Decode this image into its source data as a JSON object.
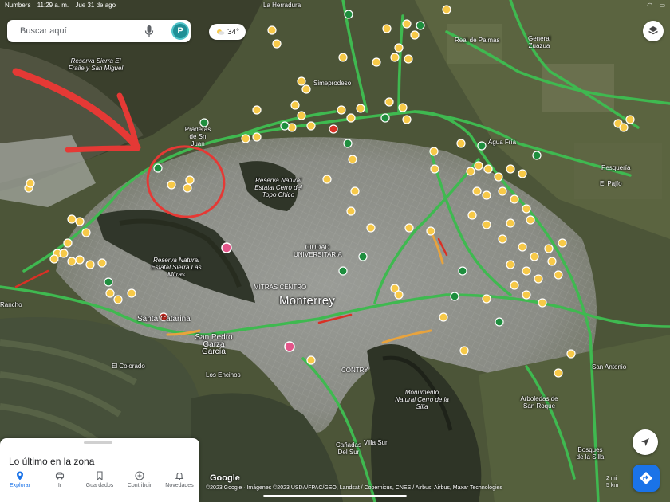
{
  "status_bar": {
    "carrier": "Numbers",
    "time": "11:29 a. m.",
    "date": "Jue 31 de ago",
    "battery": ""
  },
  "search": {
    "placeholder": "Buscar aquí",
    "avatar_letter": "P"
  },
  "weather": {
    "temp": "34°",
    "icon": "partly-cloudy-icon"
  },
  "map": {
    "labels": {
      "sierra_fraile": "Reserva Sierra El Fraile y San Miguel",
      "la_herradura": "La Herradura",
      "simeprodeso": "Simeprodeso",
      "praderas": "Praderas de Sn Juan",
      "real_palmas": "Real de Palmas",
      "general_zuazua": "General Zuazua",
      "pesqueria": "Pesquería",
      "el_pajio": "El Pajío",
      "agua_fria": "Agua Fría",
      "cerro_topo": "Reserva Natural Estatal Cerro del Topo Chico",
      "ciudad_universitaria": "CIUDAD UNIVERSITARIA",
      "mitras_centro": "MITRAS CENTRO",
      "monterrey": "Monterrey",
      "sierra_mitras": "Reserva Natural Estatal Sierra Las Mitras",
      "santa_catarina": "Santa Catarina",
      "san_pedro": "San Pedro Garza García",
      "los_encinos": "Los Encinos",
      "el_colorado": "El Colorado",
      "cerro_silla": "Monumento Natural Cerro de la Silla",
      "contry": "CONTRY",
      "canadas": "Cañadas Del Sur",
      "villa_sur": "Villa Sur",
      "arboledas": "Arboledas de San Roque",
      "san_antonio": "San Antonio",
      "bosques": "Bosques de la Silla",
      "rancho": "Rancho"
    },
    "annotation_color": "#e53935",
    "traffic_colors": {
      "free": "#3fb950",
      "slow": "#e8a33d",
      "heavy": "#d93025"
    }
  },
  "panel": {
    "title": "Lo último en la zona"
  },
  "nav": [
    {
      "label": "Explorar",
      "icon": "pin-icon",
      "active": true
    },
    {
      "label": "Ir",
      "icon": "car-icon",
      "active": false
    },
    {
      "label": "Guardados",
      "icon": "bookmark-icon",
      "active": false
    },
    {
      "label": "Contribuir",
      "icon": "plus-circle-icon",
      "active": false
    },
    {
      "label": "Novedades",
      "icon": "bell-icon",
      "active": false
    }
  ],
  "footer": {
    "google": "Google",
    "attribution": "©2023 Google · Imágenes ©2023 USDA/FPAC/GEO, Landsat / Copernicus, CNES / Airbus, Airbus, Maxar Technologies",
    "scale_top": "2 mi",
    "scale_bottom": "5 km"
  },
  "colors": {
    "accent": "#1a73e8",
    "poi_yellow": "#f7c948"
  }
}
